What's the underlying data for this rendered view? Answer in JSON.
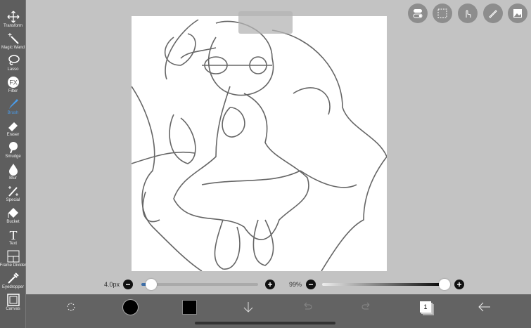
{
  "tools": [
    {
      "label": "Transform",
      "icon": "move-icon"
    },
    {
      "label": "Magic Wand",
      "icon": "magic-wand-icon"
    },
    {
      "label": "Lasso",
      "icon": "lasso-icon"
    },
    {
      "label": "Filter",
      "icon": "fx-icon",
      "glyph": "FX"
    },
    {
      "label": "Brush",
      "icon": "brush-icon",
      "active": true
    },
    {
      "label": "Eraser",
      "icon": "eraser-icon"
    },
    {
      "label": "Smudge",
      "icon": "smudge-icon"
    },
    {
      "label": "Blur",
      "icon": "blur-drop-icon"
    },
    {
      "label": "Special",
      "icon": "special-wand-icon"
    },
    {
      "label": "Bucket",
      "icon": "bucket-icon"
    },
    {
      "label": "Text",
      "icon": "text-icon",
      "glyph": "T"
    },
    {
      "label": "Frame Divider",
      "icon": "frame-divider-icon"
    },
    {
      "label": "Eyedropper",
      "icon": "eyedropper-icon"
    },
    {
      "label": "Canvas",
      "icon": "canvas-icon"
    }
  ],
  "brush": {
    "size_label": "4.0px",
    "size_fraction": 0.04,
    "opacity_label": "99%",
    "opacity_fraction": 0.99
  },
  "colors": {
    "accent": "#4a9be8",
    "primary": "#000000",
    "toolbar": "#5e5e5e",
    "background": "#c3c3c3"
  },
  "layers": {
    "count": "1"
  }
}
